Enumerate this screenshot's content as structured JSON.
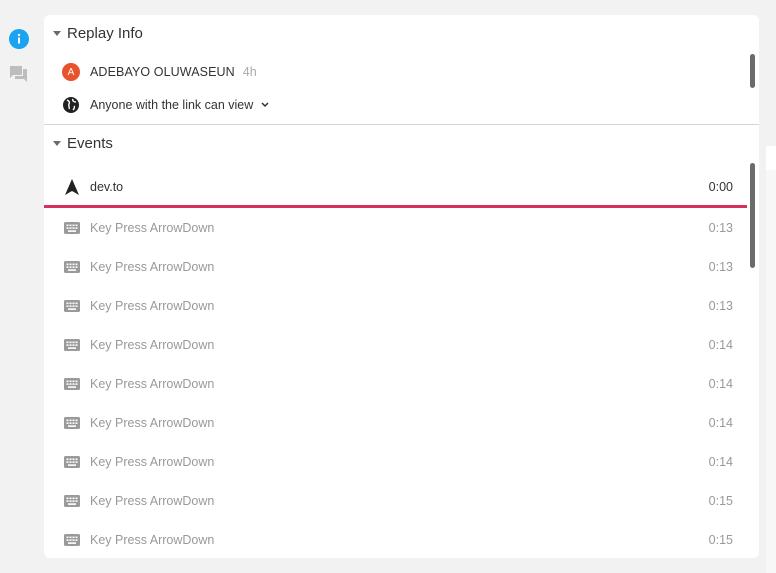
{
  "sidebar": {
    "items": [
      {
        "icon": "info-icon",
        "active": true,
        "color": "#1aa3f0"
      },
      {
        "icon": "comments-icon",
        "active": false,
        "color": "#bdbdbd"
      }
    ]
  },
  "replay_info": {
    "title": "Replay Info",
    "user": {
      "initial": "A",
      "name": "ADEBAYO OLUWASEUN",
      "time": "4h",
      "avatar_color": "#e8532b"
    },
    "sharing": {
      "icon": "globe-icon",
      "label": "Anyone with the link can view"
    }
  },
  "events": {
    "title": "Events",
    "items": [
      {
        "icon": "navigation-icon",
        "label": "dev.to",
        "time": "0:00",
        "current": true
      },
      {
        "icon": "keyboard-icon",
        "label": "Key Press ArrowDown",
        "time": "0:13"
      },
      {
        "icon": "keyboard-icon",
        "label": "Key Press ArrowDown",
        "time": "0:13"
      },
      {
        "icon": "keyboard-icon",
        "label": "Key Press ArrowDown",
        "time": "0:13"
      },
      {
        "icon": "keyboard-icon",
        "label": "Key Press ArrowDown",
        "time": "0:14"
      },
      {
        "icon": "keyboard-icon",
        "label": "Key Press ArrowDown",
        "time": "0:14"
      },
      {
        "icon": "keyboard-icon",
        "label": "Key Press ArrowDown",
        "time": "0:14"
      },
      {
        "icon": "keyboard-icon",
        "label": "Key Press ArrowDown",
        "time": "0:14"
      },
      {
        "icon": "keyboard-icon",
        "label": "Key Press ArrowDown",
        "time": "0:15"
      },
      {
        "icon": "keyboard-icon",
        "label": "Key Press ArrowDown",
        "time": "0:15"
      }
    ],
    "progress_color": "#d6305c"
  }
}
